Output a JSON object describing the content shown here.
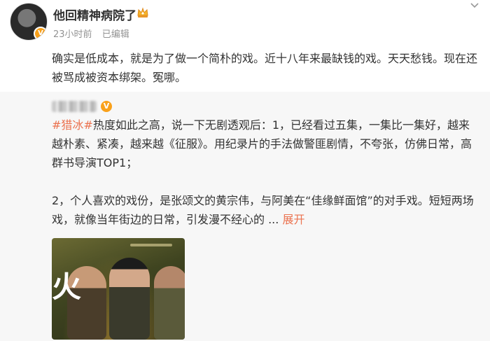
{
  "post": {
    "username": "他回精神病院了",
    "timestamp": "23小时前",
    "edited": "已编辑",
    "text": "确实是低成本，就是为了做一个简朴的戏。近十八年来最缺钱的戏。天天愁钱。现在还被骂成被资本绑架。冤哪。"
  },
  "repost": {
    "hashtag": "#猎冰#",
    "para1_rest": "热度如此之高，说一下无剧透观后：1，已经看过五集，一集比一集好，越来越朴素、紧凑，越来越《征服》。用纪录片的手法做警匪剧情，不夸张，仿佛日常，高群书导演TOP1；",
    "para2": "2，个人喜欢的戏份，是张颂文的黄宗伟，与阿美在“佳缘鲜面馆”的对手戏。短短两场戏，就像当年街边的日常，引发漫不经心的 ...",
    "expand_label": "展开",
    "poster_glyph": "火"
  },
  "colors": {
    "link": "#eb7350",
    "meta": "#939393",
    "badge": "#f9a11b",
    "repost_bg": "#f7f7f7"
  }
}
